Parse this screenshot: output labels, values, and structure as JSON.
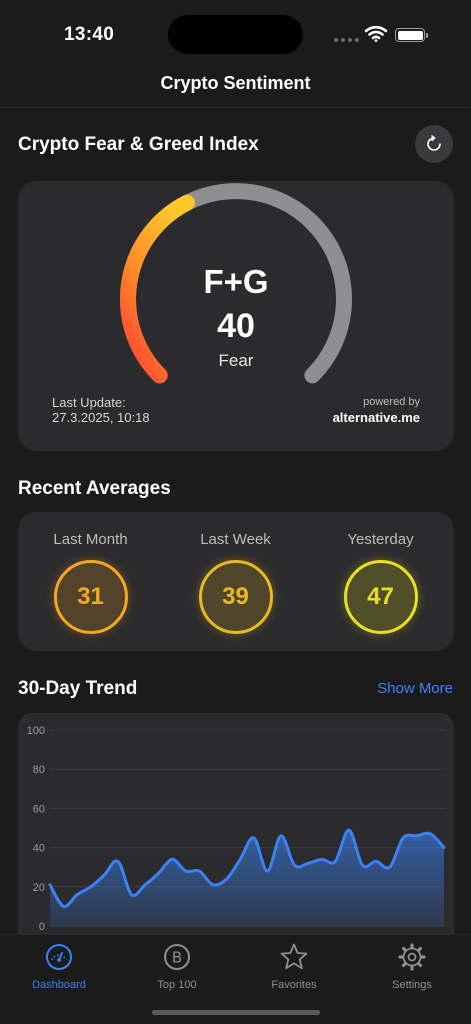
{
  "status": {
    "time": "13:40"
  },
  "nav": {
    "title": "Crypto Sentiment"
  },
  "index": {
    "title": "Crypto Fear & Greed Index",
    "label": "F+G",
    "value": 40,
    "classification": "Fear",
    "last_update_label": "Last Update:",
    "last_update_value": "27.3.2025, 10:18",
    "powered_by": "powered by",
    "source": "alternative.me"
  },
  "averages": {
    "title": "Recent Averages",
    "items": [
      {
        "label": "Last Month",
        "value": "31",
        "color": "#f5a623"
      },
      {
        "label": "Last Week",
        "value": "39",
        "color": "#e8b923"
      },
      {
        "label": "Yesterday",
        "value": "47",
        "color": "#e8e020"
      }
    ]
  },
  "trend": {
    "title": "30-Day Trend",
    "show_more": "Show More"
  },
  "chart_data": {
    "type": "area",
    "y_ticks": [
      "100",
      "80",
      "60",
      "40",
      "20",
      "0"
    ],
    "ylim": [
      0,
      100
    ],
    "values": [
      21,
      10,
      16,
      20,
      26,
      33,
      16,
      21,
      27,
      34,
      28,
      28,
      21,
      24,
      34,
      45,
      28,
      46,
      31,
      32,
      34,
      33,
      49,
      31,
      33,
      30,
      45,
      46,
      47,
      40
    ],
    "line_color": "#3b82f6",
    "grid": true
  },
  "tabs": [
    {
      "label": "Dashboard",
      "icon": "gauge-icon",
      "active": true
    },
    {
      "label": "Top 100",
      "icon": "bitcoin-icon",
      "active": false
    },
    {
      "label": "Favorites",
      "icon": "star-icon",
      "active": false
    },
    {
      "label": "Settings",
      "icon": "gear-icon",
      "active": false
    }
  ]
}
